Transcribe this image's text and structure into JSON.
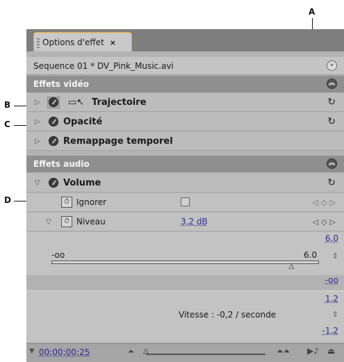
{
  "callouts": {
    "a": "A",
    "b": "B",
    "c": "C",
    "d": "D"
  },
  "panel": {
    "tab_title": "Options d'effet",
    "tab_close": "×",
    "sequence": "Sequence 01 * DV_Pink_Music.avi",
    "video_header": "Effets vidéo",
    "effects_video": [
      {
        "name": "Trajectoire"
      },
      {
        "name": "Opacité"
      },
      {
        "name": "Remappage temporel"
      }
    ],
    "audio_header": "Effets audio",
    "volume": {
      "name": "Volume",
      "ignore_label": "Ignorer",
      "level_label": "Niveau",
      "level_value": "3,2 dB",
      "max_value": "6,0",
      "slider_min": "-oo",
      "slider_max": "6.0",
      "slider_fraction": 0.9,
      "neg_inf": "-oo",
      "vel_max": "1,2",
      "velocity": "Vitesse : -0,2 / seconde",
      "vel_min": "-1,2"
    },
    "timecode": "00;00;00;25"
  },
  "icons": {
    "collapse": "chevron-double-up-icon",
    "expand": "chevron-double-right-icon",
    "reset": "reset-icon",
    "stopwatch": "stopwatch-icon",
    "fx": "fx-toggle-icon"
  },
  "colors": {
    "tab_border": "#f0a51a",
    "value_blue": "#2a2a9a"
  }
}
